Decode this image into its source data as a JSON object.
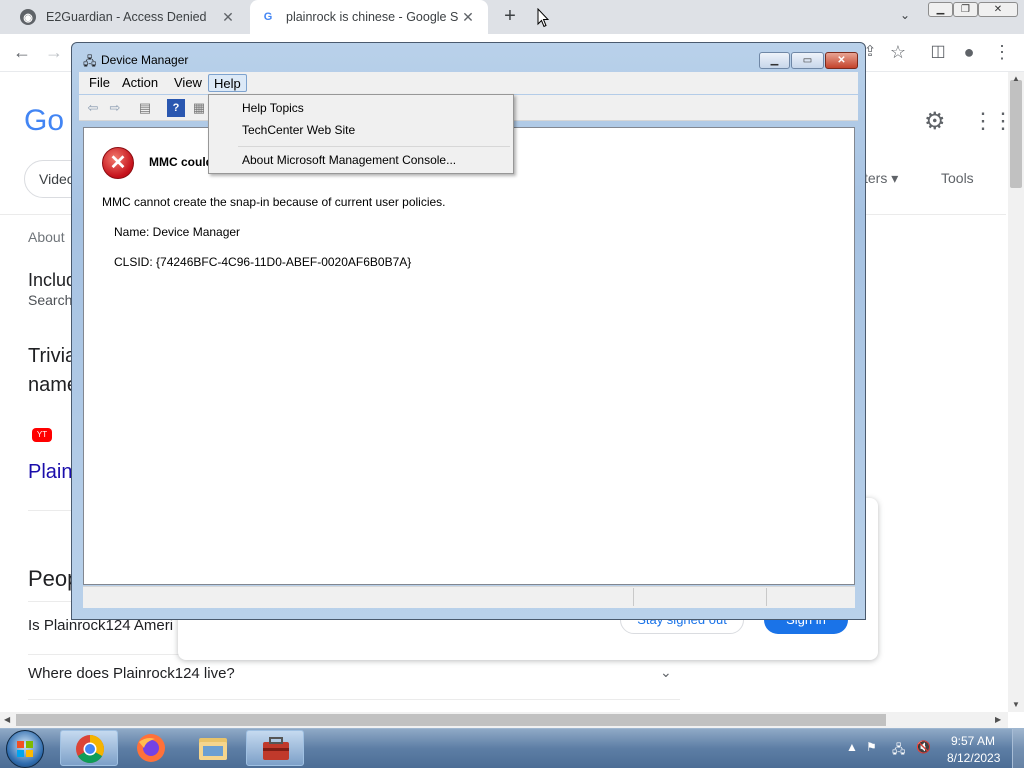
{
  "chrome": {
    "tabs": [
      {
        "title": "E2Guardian - Access Denied"
      },
      {
        "title": "plainrock is chinese - Google Search"
      }
    ],
    "new_tab": "+",
    "tab_search": "⌄",
    "close_glyph": "✕"
  },
  "google": {
    "logo": "Go",
    "chip_videos": "Videos",
    "filters": "ters ▾",
    "tools": "Tools",
    "about": "About",
    "includ": "Includ",
    "search_line": "Search",
    "trivia": "Trivia name",
    "yt_label": "YT",
    "plain_link": "Plain",
    "people": "Peop",
    "q1": "Is Plainrock124 Ameri",
    "q2": "Where does Plainrock124 live?",
    "stay_signed_out": "Stay signed out",
    "sign_in": "Sign in"
  },
  "device_manager": {
    "title": "Device Manager",
    "menus": [
      "File",
      "Action",
      "View",
      "Help"
    ],
    "help_menu": [
      "Help Topics",
      "TechCenter Web Site",
      "About Microsoft Management Console..."
    ],
    "error_heading": "MMC could",
    "error_message": "MMC cannot create the snap-in because of current user policies.",
    "name_line": "Name: Device Manager",
    "clsid_line": "CLSID: {74246BFC-4C96-11D0-ABEF-0020AF6B0B7A}"
  },
  "taskbar": {
    "time": "9:57 AM",
    "date": "8/12/2023"
  },
  "colors": {
    "google_blue": "#1a73e8",
    "link_blue": "#1a0dab",
    "error_red": "#c4101a",
    "taskbar": "#5d7ea5"
  }
}
